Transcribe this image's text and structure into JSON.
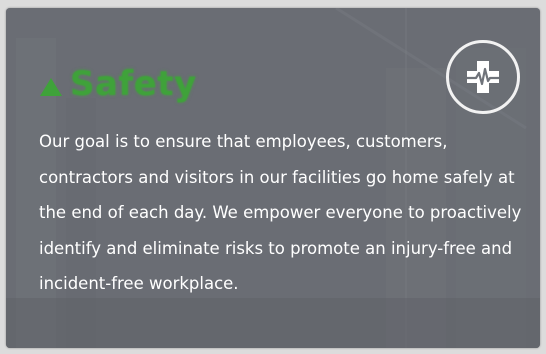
{
  "card": {
    "title": "Safety",
    "icon": "medical-cross-heartbeat-icon",
    "accent_color": "#3fa23a",
    "text_color": "#ffffff",
    "body": "Our goal is to ensure that employees, customers, contractors and visitors in our facilities go home safely at the end of each day. We empower everyone to proactively identify and eliminate risks to promote an injury-free and incident-free workplace."
  }
}
